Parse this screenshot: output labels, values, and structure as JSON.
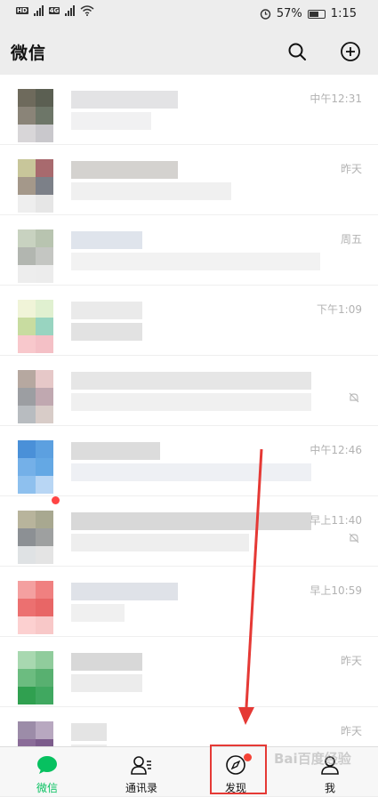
{
  "status": {
    "left_labels": [
      "HD",
      "4G",
      "4G"
    ],
    "alarm_icon": "alarm-clock-icon",
    "battery": "57%",
    "time": "1:15"
  },
  "title_bar": {
    "title": "微信",
    "search_icon": "search-icon",
    "add_icon": "add-circle-icon"
  },
  "chats": [
    {
      "time": "中午12:31",
      "muted": false
    },
    {
      "time": "昨天",
      "muted": false
    },
    {
      "time": "周五",
      "muted": false
    },
    {
      "time": "下午1:09",
      "muted": false
    },
    {
      "time": "",
      "muted": true
    },
    {
      "time": "中午12:46",
      "muted": false
    },
    {
      "time": "早上11:40",
      "muted": true
    },
    {
      "time": "早上10:59",
      "muted": false
    },
    {
      "time": "昨天",
      "muted": false
    },
    {
      "time": "昨天",
      "muted": false
    }
  ],
  "tab_bar": {
    "tabs": [
      {
        "label": "微信",
        "icon": "chat-bubble-icon",
        "active": true
      },
      {
        "label": "通讯录",
        "icon": "contacts-icon",
        "active": false
      },
      {
        "label": "发现",
        "icon": "compass-icon",
        "active": false,
        "badge": true
      },
      {
        "label": "我",
        "icon": "person-icon",
        "active": false
      }
    ]
  },
  "colors": {
    "accent": "#07c160",
    "badge": "#f44336",
    "annotation": "#e53935"
  },
  "watermark": "Bai百度经验"
}
